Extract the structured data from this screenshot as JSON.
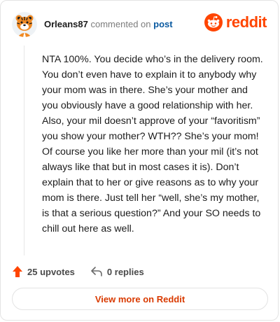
{
  "header": {
    "username": "Orleans87",
    "action_text": "commented on",
    "post_link": "post",
    "brand": "reddit"
  },
  "comment": {
    "body": "NTA 100%. You decide who’s in the delivery room. You don’t even have to explain it to anybody why your mom was in there. She’s your mother and you obviously have a good relationship with her. Also, your mil doesn’t approve of your “favoritism” you show your mother? WTH?? She’s your mom! Of course you like her more than your mil (it’s not always like that but in most cases it is). Don’t explain that to her or give reasons as to why your mom is there. Just tell her “well, she’s my mother, is that a serious question?” And your SO needs to chill out here as well."
  },
  "actions": {
    "upvotes": "25 upvotes",
    "replies": "0 replies"
  },
  "footer": {
    "view_more": "View more on Reddit"
  },
  "colors": {
    "brand": "#ff4500",
    "link": "#0a5aa0",
    "cta": "#d93a00"
  },
  "icons": {
    "avatar": "tiger-avatar",
    "brand": "reddit-snoo-logo",
    "upvote": "upvote-arrow-icon",
    "reply": "reply-arrow-icon"
  }
}
